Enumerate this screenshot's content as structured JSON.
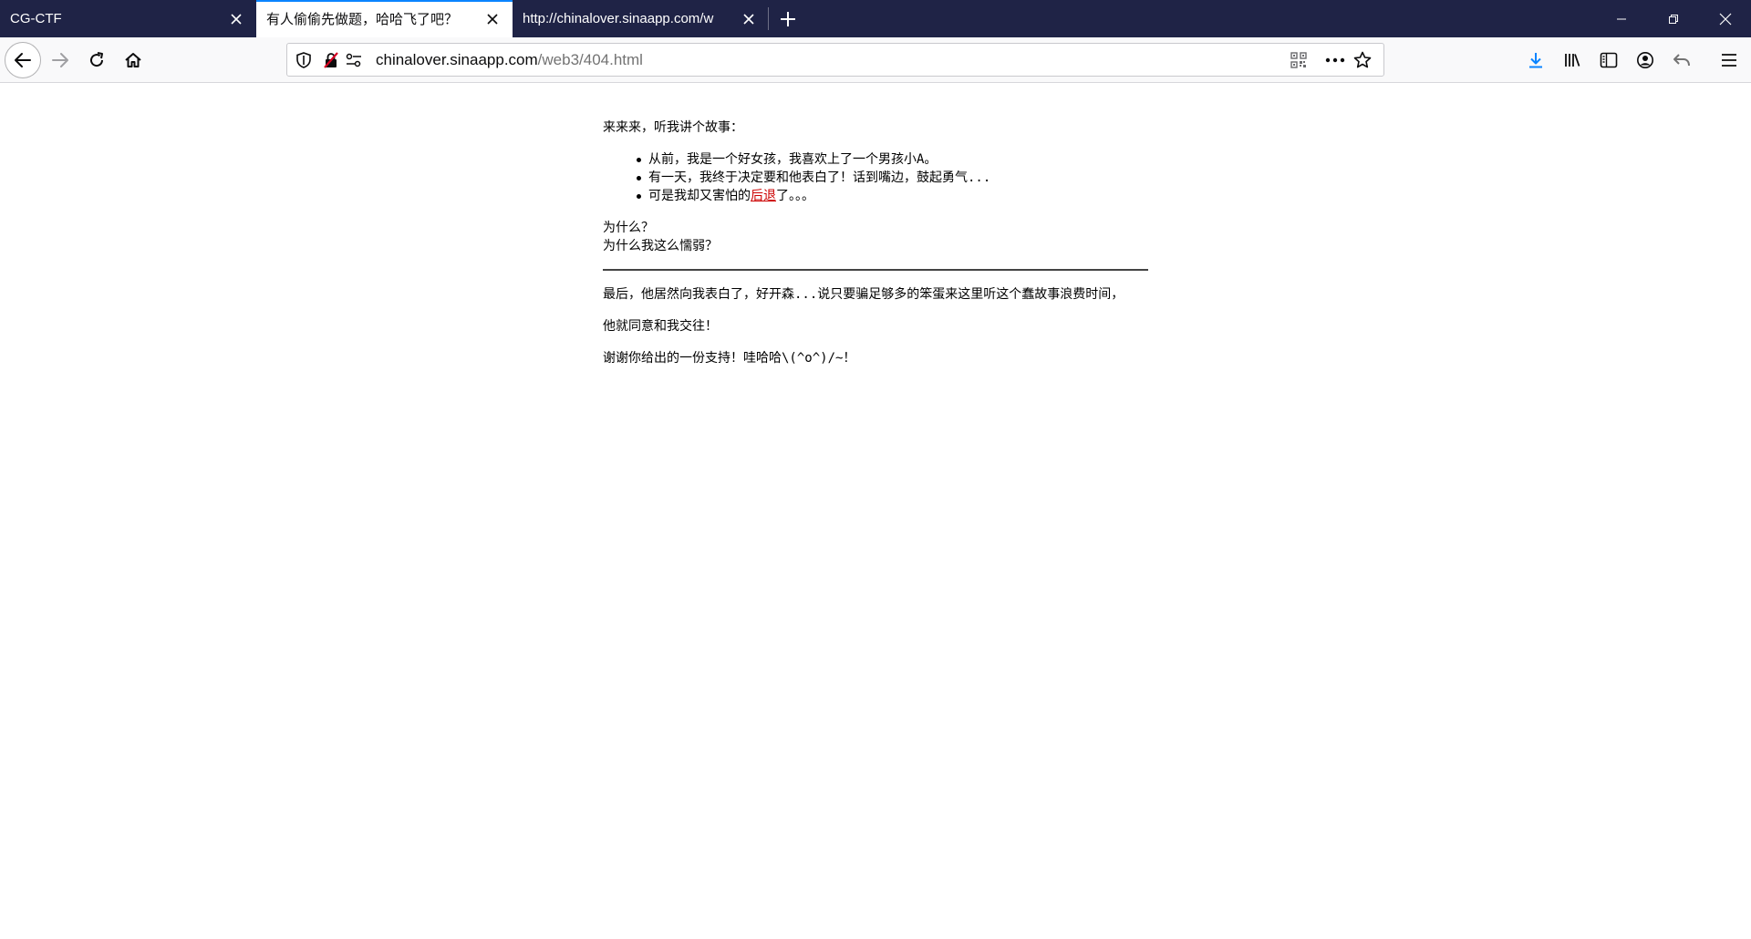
{
  "tabs": [
    {
      "title": "CG-CTF",
      "active": false
    },
    {
      "title": "有人偷偷先做题，哈哈飞了吧？",
      "active": true
    },
    {
      "title": "http://chinalover.sinaapp.com/w",
      "active": false
    }
  ],
  "window": {
    "minimize_icon": "minimize-icon",
    "restore_icon": "restore-icon",
    "close_icon": "close-icon"
  },
  "urlbar": {
    "host": "chinalover.sinaapp.com",
    "path": "/web3/404.html"
  },
  "page": {
    "intro": "来来来，听我讲个故事：",
    "story": [
      "从前，我是一个好女孩，我喜欢上了一个男孩小A。",
      "有一天，我终于决定要和他表白了！话到嘴边，鼓起勇气...",
      "可是我却又害怕的"
    ],
    "story_link": "后退",
    "story_end": "了。。。",
    "why1": "为什么？",
    "why2": "为什么我这么懦弱？",
    "ending": "最后，他居然向我表白了，好开森...说只要骗足够多的笨蛋来这里听这个蠢故事浪费时间，",
    "agree": "他就同意和我交往！",
    "thanks": "谢谢你给出的一份支持！哇哈哈\\(^o^)/~！"
  },
  "colors": {
    "tabbar": "#1f2346",
    "accent": "#0a84ff",
    "link": "#cc0000",
    "download": "#0a84ff"
  }
}
